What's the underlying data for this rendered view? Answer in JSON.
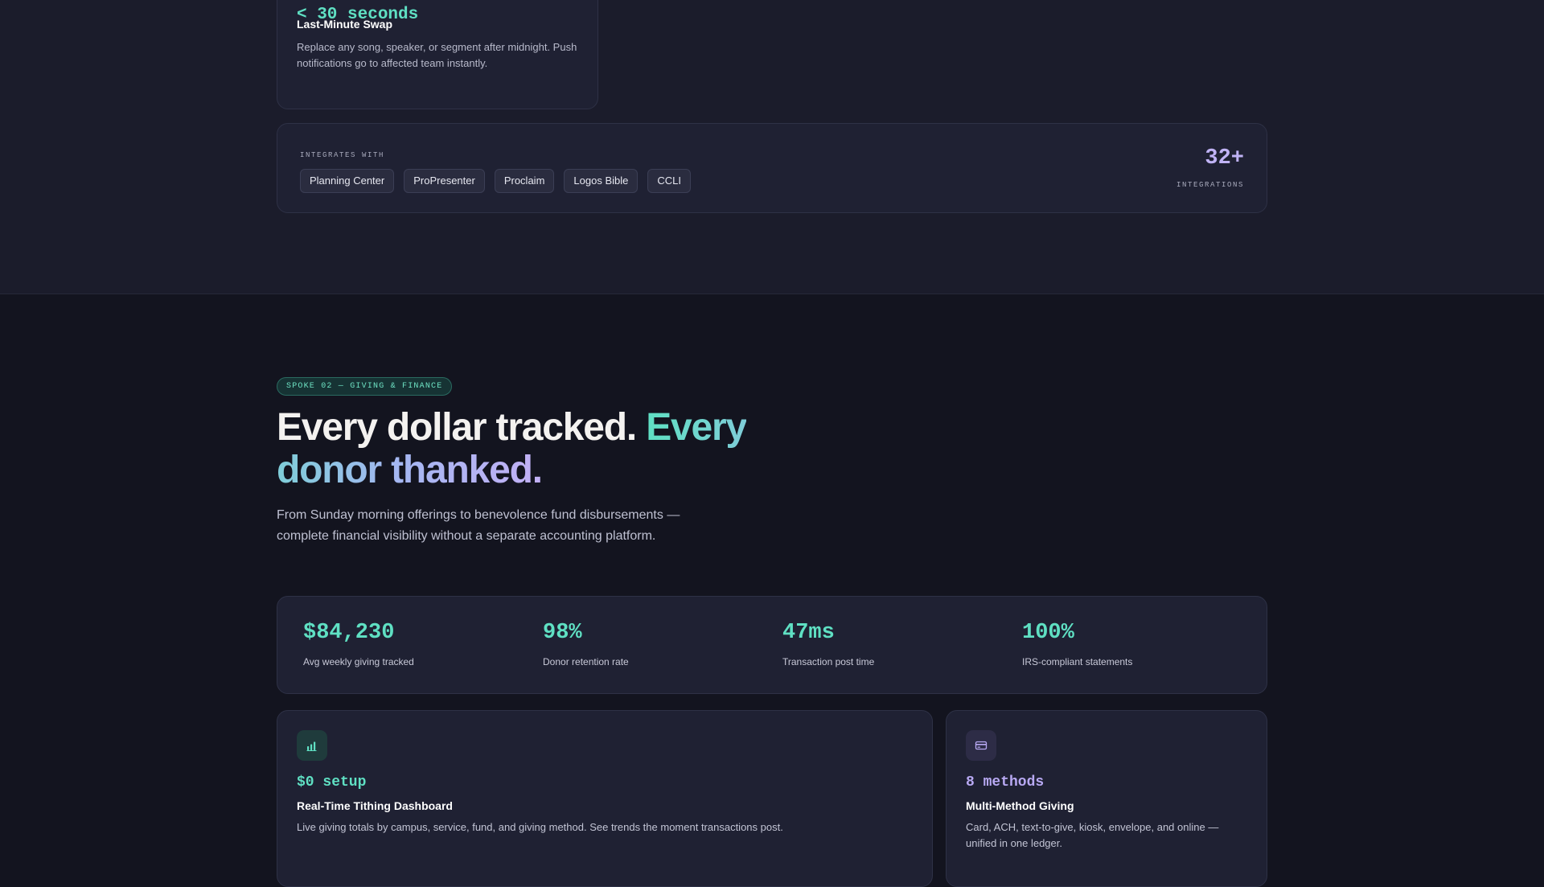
{
  "swap_card": {
    "metric": "< 30 seconds",
    "title": "Last-Minute Swap",
    "description": "Replace any song, speaker, or segment after midnight. Push notifications go to affected team instantly."
  },
  "integrations": {
    "label": "INTEGRATES WITH",
    "chips": [
      "Planning Center",
      "ProPresenter",
      "Proclaim",
      "Logos Bible",
      "CCLI"
    ],
    "count": "32+",
    "count_label": "INTEGRATIONS"
  },
  "giving": {
    "badge": "SPOKE 02 — GIVING & FINANCE",
    "headline_plain": "Every dollar tracked. ",
    "headline_accent": "Every donor thanked.",
    "lede": "From Sunday morning offerings to benevolence fund disbursements — complete financial visibility without a separate accounting platform.",
    "stats": [
      {
        "value": "$84,230",
        "label": "Avg weekly giving tracked"
      },
      {
        "value": "98%",
        "label": "Donor retention rate"
      },
      {
        "value": "47ms",
        "label": "Transaction post time"
      },
      {
        "value": "100%",
        "label": "IRS-compliant statements"
      }
    ],
    "features": [
      {
        "icon": "bar-chart-icon",
        "metric": "$0 setup",
        "title": "Real-Time Tithing Dashboard",
        "description": "Live giving totals by campus, service, fund, and giving method. See trends the moment transactions post."
      },
      {
        "icon": "credit-card-icon",
        "metric": "8 methods",
        "title": "Multi-Method Giving",
        "description": "Card, ACH, text-to-give, kiosk, envelope, and online — unified in one ledger."
      }
    ]
  },
  "colors": {
    "accent_teal": "#5fe0c3",
    "accent_purple": "#c0b3f5",
    "background_top": "#1b1c2b",
    "background_bottom": "#13141f"
  }
}
